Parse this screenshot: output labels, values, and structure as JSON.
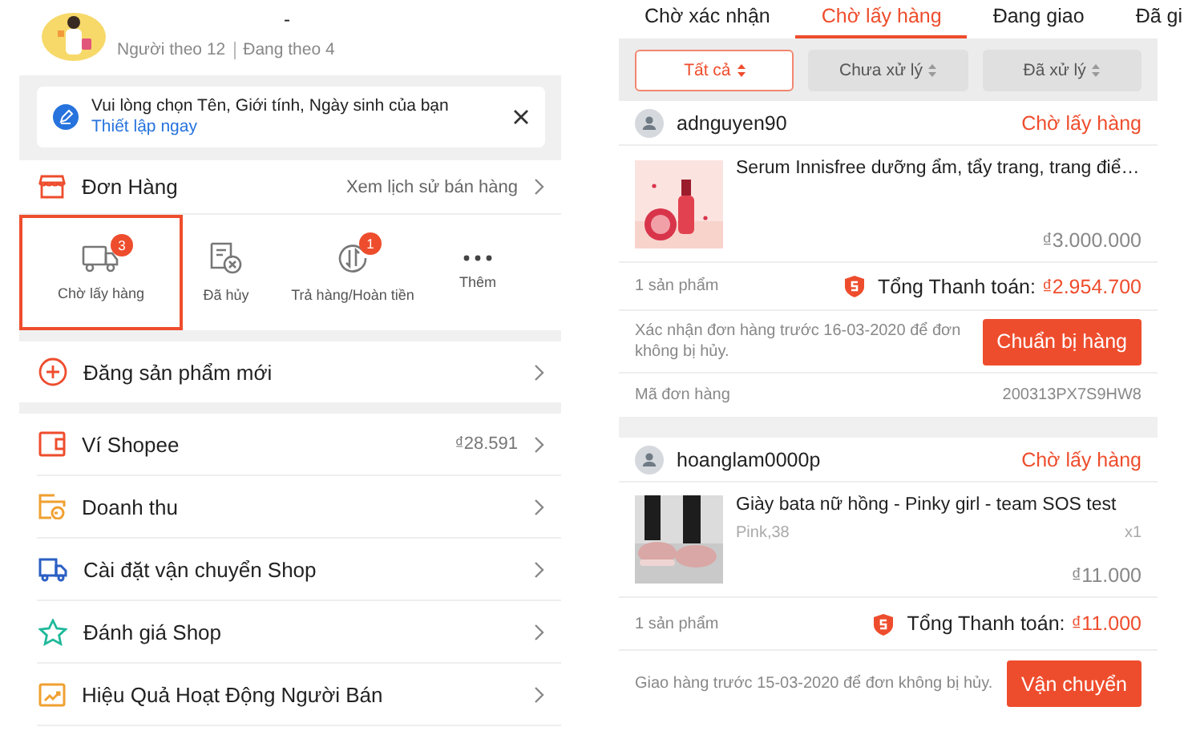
{
  "profile": {
    "name": "-",
    "followers": "Người theo 12",
    "following": "Đang theo 4"
  },
  "notice": {
    "text": "Vui lòng chọn Tên, Giới tính, Ngày sinh của bạn",
    "link": "Thiết lập ngay"
  },
  "orders_section": {
    "title": "Đơn Hàng",
    "link": "Xem lịch sử bán hàng",
    "statuses": [
      {
        "label": "Chờ lấy hàng",
        "badge": "3",
        "selected": true
      },
      {
        "label": "Đã hủy",
        "selected": false
      },
      {
        "label": "Trả hàng/Hoàn tiền",
        "badge": "1",
        "selected": false
      },
      {
        "label": "Thêm",
        "selected": false
      }
    ]
  },
  "add_product": {
    "label": "Đăng sản phẩm mới"
  },
  "menu": [
    {
      "label": "Ví Shopee",
      "value": "₫28.591"
    },
    {
      "label": "Doanh thu"
    },
    {
      "label": "Cài đặt vận chuyển Shop"
    },
    {
      "label": "Đánh giá Shop"
    },
    {
      "label": "Hiệu Quả Hoạt Động Người Bán"
    }
  ],
  "tabs": [
    {
      "label": "Chờ xác nhận",
      "selected": false
    },
    {
      "label": "Chờ lấy hàng",
      "selected": true
    },
    {
      "label": "Đang giao",
      "selected": false
    },
    {
      "label": "Đã gi",
      "selected": false
    }
  ],
  "filters": [
    {
      "label": "Tất cả",
      "selected": true
    },
    {
      "label": "Chưa xử lý",
      "selected": false
    },
    {
      "label": "Đã xử lý",
      "selected": false
    }
  ],
  "orders": [
    {
      "buyer": "adnguyen90",
      "status": "Chờ lấy hàng",
      "product": {
        "name": "Serum Innisfree dưỡng ẩm, tẩy trang, trang điể…",
        "price": "₫3.000.000"
      },
      "count": "1 sản phẩm",
      "total_label": "Tổng Thanh toán:",
      "total": "₫2.954.700",
      "deadline": "Xác nhận đơn hàng trước 16-03-2020 để đơn không bị hủy.",
      "action": "Chuẩn bị hàng",
      "code_label": "Mã đơn hàng",
      "code": "200313PX7S9HW8"
    },
    {
      "buyer": "hoanglam0000p",
      "status": "Chờ lấy hàng",
      "product": {
        "name": "Giày bata nữ hồng - Pinky girl - team SOS test",
        "variant": "Pink,38",
        "quantity": "x1",
        "price": "₫11.000"
      },
      "count": "1 sản phẩm",
      "total_label": "Tổng Thanh toán:",
      "total": "₫11.000",
      "deadline": "Giao hàng trước 15-03-2020 để đơn không bị hủy.",
      "action": "Vận chuyển"
    }
  ]
}
